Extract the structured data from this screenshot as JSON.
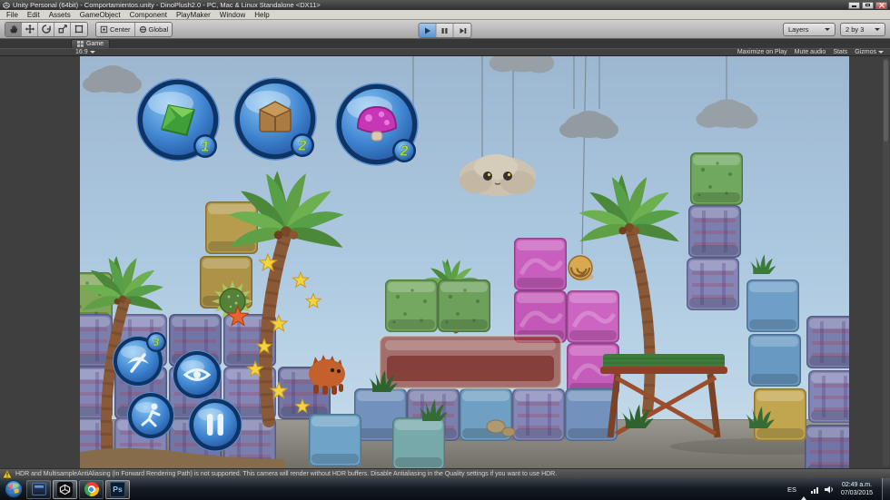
{
  "window": {
    "title": "Unity Personal (64bit) - Comportamientos.unity - DinoPlush2.0 - PC, Mac & Linux Standalone <DX11>"
  },
  "menu": {
    "items": [
      "File",
      "Edit",
      "Assets",
      "GameObject",
      "Component",
      "PlayMaker",
      "Window",
      "Help"
    ]
  },
  "toolbar": {
    "center_label": "Center",
    "global_label": "Global",
    "layers_label": "Layers",
    "layout_label": "2 by 3"
  },
  "game_view": {
    "tab_label": "Game",
    "aspect_label": "16:9",
    "maximize_label": "Maximize on Play",
    "mute_label": "Mute audio",
    "stats_label": "Stats",
    "gizmos_label": "Gizmos"
  },
  "hud": {
    "powerups": [
      {
        "name": "green-gem",
        "count": "1"
      },
      {
        "name": "crate",
        "count": "2"
      },
      {
        "name": "mushroom",
        "count": "2"
      }
    ],
    "action_badge_count": "3"
  },
  "status_bar": {
    "warning": "HDR and MultisampleAntiAliasing (in Forward Rendering Path) is not supported. This camera will render without HDR buffers. Disable Antialiasing in the Quality settings if you want to use HDR."
  },
  "taskbar": {
    "photoshop_label": "Ps",
    "tray": {
      "language": "ES",
      "time": "02:49 a.m.",
      "date": "07/03/2015"
    }
  },
  "colors": {
    "hud_button_blue": "#3F84D0",
    "badge_number_green": "#A6D44E",
    "warning_yellow": "#F2C61B",
    "play_active_blue": "#7FB2E5",
    "sky_blue": "#ADC9E0"
  }
}
